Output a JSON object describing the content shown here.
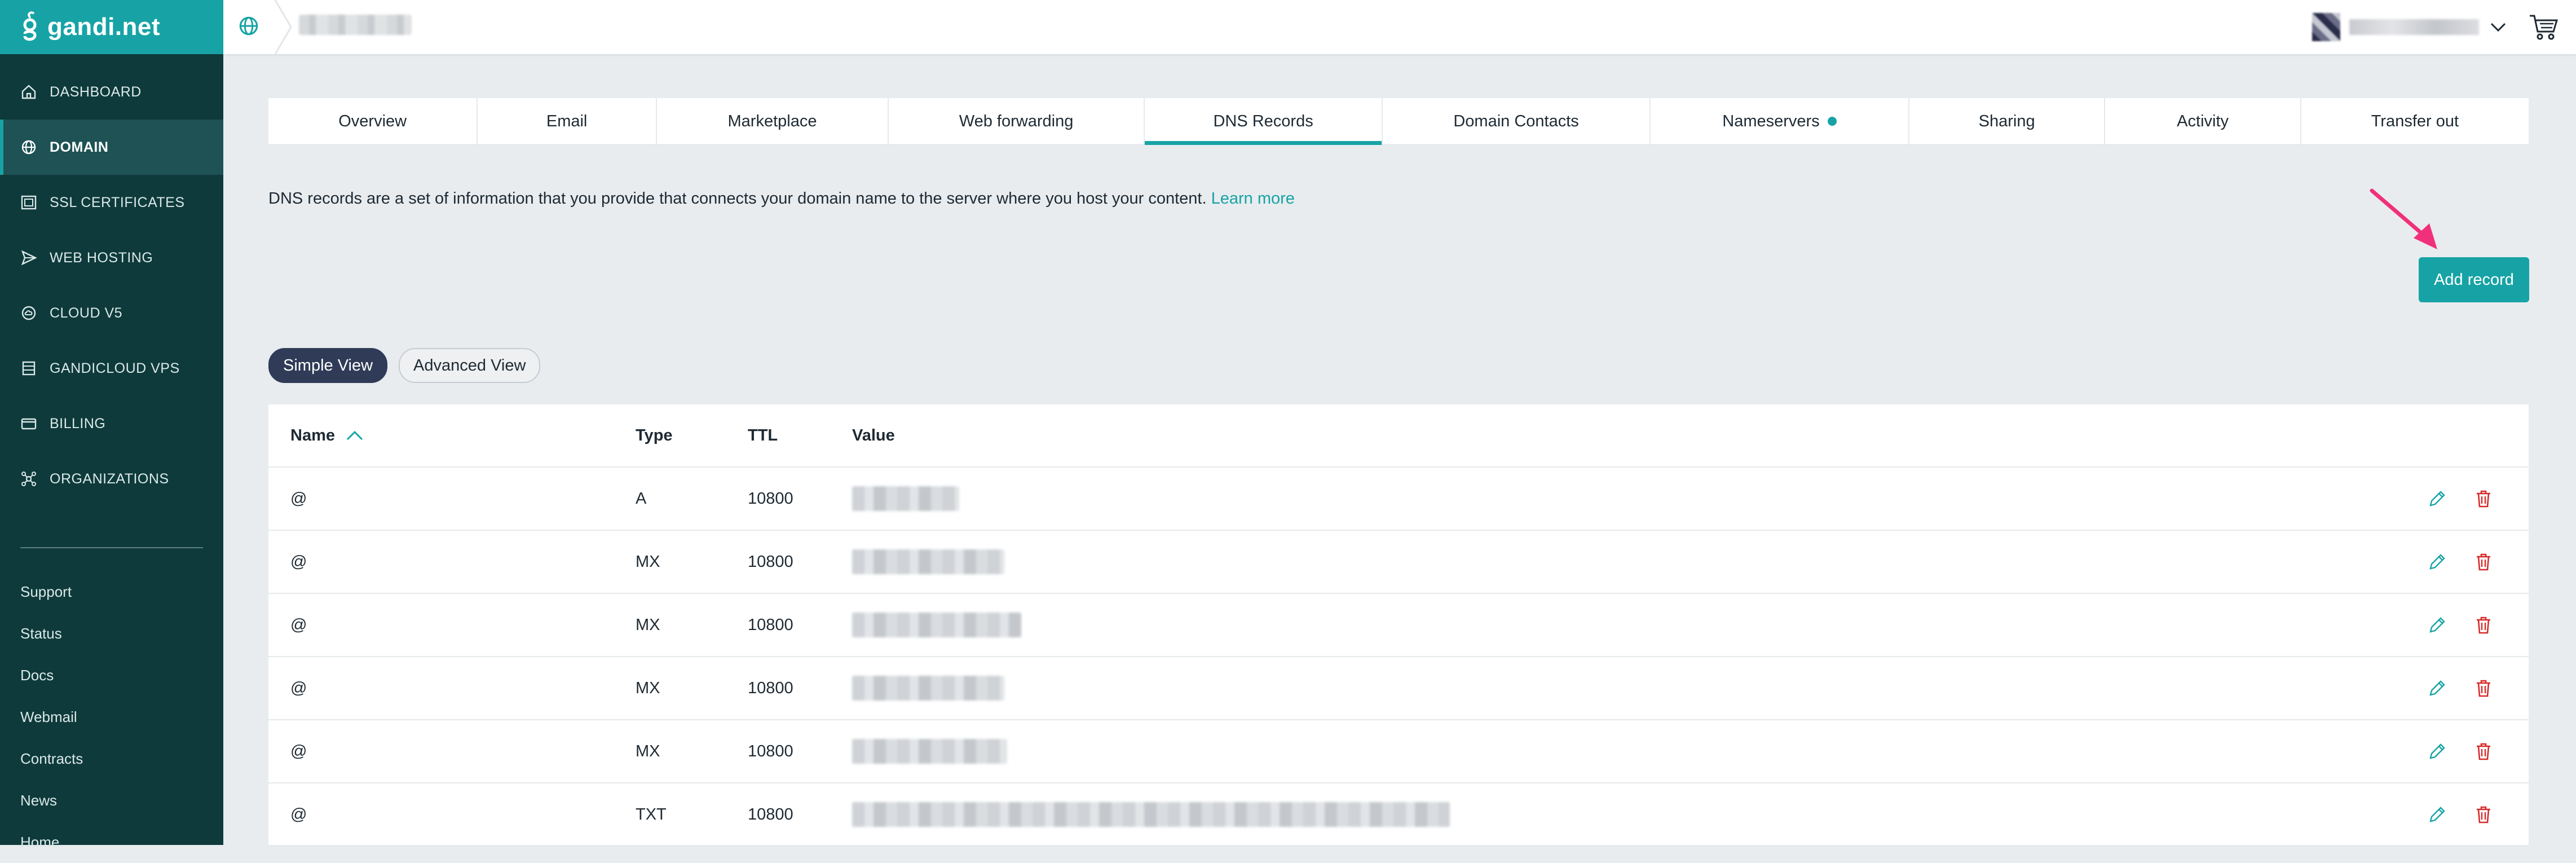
{
  "app": {
    "brand": "gandi.net",
    "accent": "#17a3a5",
    "sidebar_bg": "#0e3a3b"
  },
  "sidebar": {
    "nav": [
      {
        "label": "DASHBOARD",
        "icon": "home-icon"
      },
      {
        "label": "DOMAIN",
        "icon": "globe-icon",
        "active": true
      },
      {
        "label": "SSL CERTIFICATES",
        "icon": "certificate-icon"
      },
      {
        "label": "WEB HOSTING",
        "icon": "paper-plane-icon"
      },
      {
        "label": "CLOUD V5",
        "icon": "cloud-icon"
      },
      {
        "label": "GANDICLOUD VPS",
        "icon": "server-icon"
      },
      {
        "label": "BILLING",
        "icon": "credit-card-icon"
      },
      {
        "label": "ORGANIZATIONS",
        "icon": "organization-icon"
      }
    ],
    "links": [
      "Support",
      "Status",
      "Docs",
      "Webmail",
      "Contracts",
      "News",
      "Home"
    ]
  },
  "tabs": [
    {
      "label": "Overview"
    },
    {
      "label": "Email"
    },
    {
      "label": "Marketplace"
    },
    {
      "label": "Web forwarding"
    },
    {
      "label": "DNS Records",
      "active": true
    },
    {
      "label": "Domain Contacts"
    },
    {
      "label": "Nameservers",
      "badge": true
    },
    {
      "label": "Sharing"
    },
    {
      "label": "Activity"
    },
    {
      "label": "Transfer out"
    }
  ],
  "intro": {
    "text": "DNS records are a set of information that you provide that connects your domain name to the server where you host your content.",
    "link": "Learn more"
  },
  "add_record_label": "Add record",
  "views": {
    "simple": "Simple View",
    "advanced": "Advanced View"
  },
  "table": {
    "headers": {
      "name": "Name",
      "type": "Type",
      "ttl": "TTL",
      "value": "Value"
    },
    "rows": [
      {
        "name": "@",
        "type": "A",
        "ttl": "10800"
      },
      {
        "name": "@",
        "type": "MX",
        "ttl": "10800"
      },
      {
        "name": "@",
        "type": "MX",
        "ttl": "10800"
      },
      {
        "name": "@",
        "type": "MX",
        "ttl": "10800"
      },
      {
        "name": "@",
        "type": "MX",
        "ttl": "10800"
      },
      {
        "name": "@",
        "type": "TXT",
        "ttl": "10800"
      }
    ]
  }
}
